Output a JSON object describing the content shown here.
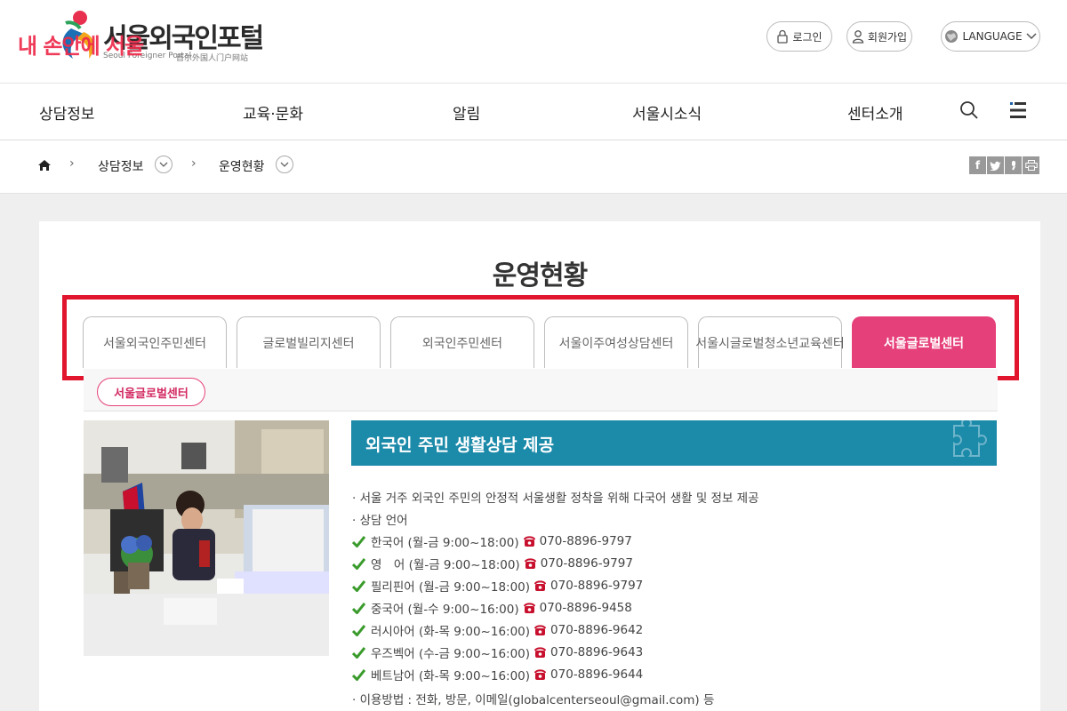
{
  "header": {
    "logo_title": "서울외국인포털",
    "logo_sub_en": "Seoul Foreigner Portal",
    "logo_sub_cn": "首尔外国人门户网站",
    "overlay_text": "내 손안에 서울",
    "login_label": "로그인",
    "join_label": "회원가입",
    "language_label": "LANGUAGE"
  },
  "nav": {
    "items": [
      "상담정보",
      "교육·문화",
      "알림",
      "서울시소식",
      "센터소개"
    ]
  },
  "breadcrumb": {
    "level1": "상담정보",
    "level2": "운영현황"
  },
  "share": {
    "icons": [
      "facebook-icon",
      "twitter-icon",
      "blog-icon",
      "print-icon"
    ]
  },
  "page": {
    "title": "운영현황",
    "tabs": [
      "서울외국인주민센터",
      "글로벌빌리지센터",
      "외국인주민센터",
      "서울이주여성상담센터",
      "서울시글로벌청소년교육센터",
      "서울글로벌센터"
    ],
    "active_tab": 5,
    "subtab": "서울글로벌센터",
    "banner_title": "외국인 주민 생활상담 제공",
    "intro": "· 서울 거주 외국인 주민의 안정적 서울생활 정착을 위해 다국어 생활 및 정보 제공",
    "lang_heading": "· 상담 언어",
    "languages": [
      {
        "name": "한국어 (월-금 9:00~18:00)",
        "phone": "070-8896-9797"
      },
      {
        "name": "영　어 (월-금 9:00~18:00)",
        "phone": "070-8896-9797"
      },
      {
        "name": "필리핀어 (월-금 9:00~18:00)",
        "phone": "070-8896-9797"
      },
      {
        "name": "중국어 (월-수 9:00~16:00)",
        "phone": "070-8896-9458"
      },
      {
        "name": "러시아어 (화-목 9:00~16:00)",
        "phone": "070-8896-9642"
      },
      {
        "name": "우즈벡어 (수-금 9:00~16:00)",
        "phone": "070-8896-9643"
      },
      {
        "name": "베트남어 (화-목 9:00~16:00)",
        "phone": "070-8896-9644"
      }
    ],
    "usage": "· 이용방법 : 전화, 방문, 이메일(globalcenterseoul@gmail.com) 등"
  },
  "colors": {
    "accent_pink": "#e6407a",
    "highlight_red": "#e1152d",
    "banner_teal": "#1c8aa9",
    "check_green": "#3a9b2c",
    "phone_red": "#c8102e"
  }
}
